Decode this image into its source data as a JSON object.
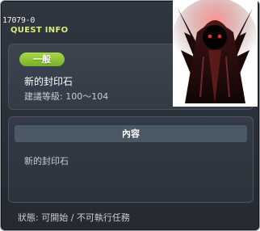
{
  "window": {
    "quest_id": "17079-0",
    "title": "QUEST INFO"
  },
  "info": {
    "category_badge": "一般",
    "quest_name": "新的封印石",
    "level_requirement": "建議等級: 100～104"
  },
  "content": {
    "header": "內容",
    "text": "新的封印石"
  },
  "status": {
    "text": "狀態: 可開始 / 不可執行任務"
  },
  "portrait": {
    "icon": "hooded-dark-figure"
  },
  "colors": {
    "badge_green": "#8cc43a",
    "title_yellow": "#d9ec7c",
    "panel_bg": "#3c4450",
    "window_bg": "#2a2f37"
  }
}
